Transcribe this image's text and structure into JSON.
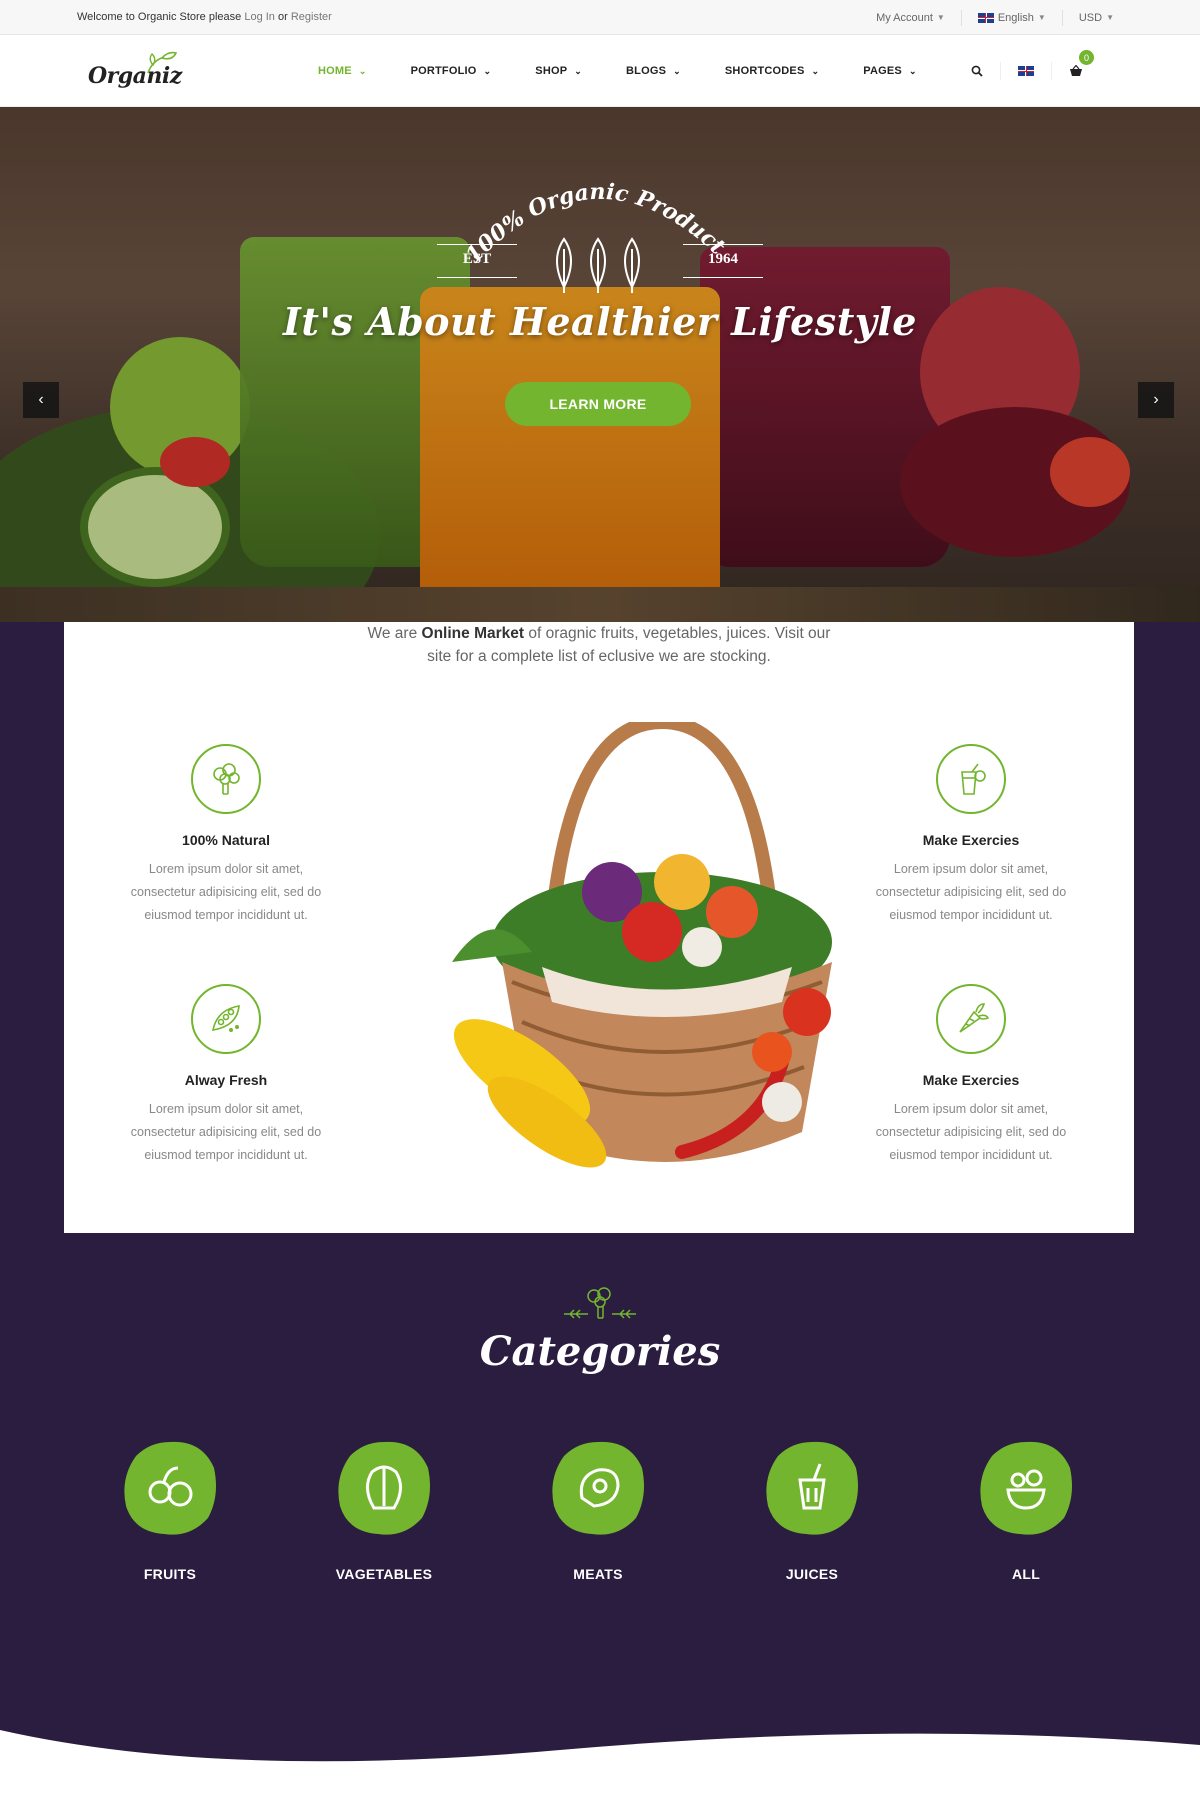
{
  "topbar": {
    "welcome_prefix": "Welcome to Organic Store please",
    "login": "Log In",
    "or": "or",
    "register": "Register",
    "account": "My Account",
    "language": "English",
    "currency": "USD"
  },
  "header": {
    "logo": "Organiz",
    "nav": [
      {
        "label": "HOME"
      },
      {
        "label": "PORTFOLIO"
      },
      {
        "label": "SHOP"
      },
      {
        "label": "BLOGS"
      },
      {
        "label": "SHORTCODES"
      },
      {
        "label": "PAGES"
      }
    ],
    "cart_count": "0"
  },
  "hero": {
    "tagline": "100% Organic Products",
    "est": "EST",
    "year": "1964",
    "title": "It's About Healthier Lifestyle",
    "button": "LEARN MORE"
  },
  "intro": {
    "prefix": "We are",
    "highlight": "Online Market",
    "line1_rest": "of oragnic fruits, vegetables, juices. Visit our",
    "line2": "site for a complete list of eclusive we are stocking."
  },
  "features": [
    {
      "title": "100% Natural",
      "icon": "broccoli-icon",
      "desc": "Lorem ipsum dolor sit amet, consectetur adipisicing elit, sed do eiusmod tempor incididunt ut."
    },
    {
      "title": "Alway Fresh",
      "icon": "peas-icon",
      "desc": "Lorem ipsum dolor sit amet, consectetur adipisicing elit, sed do eiusmod tempor incididunt ut."
    },
    {
      "title": "Make Exercies",
      "icon": "juice-icon",
      "desc": "Lorem ipsum dolor sit amet, consectetur adipisicing elit, sed do eiusmod tempor incididunt ut."
    },
    {
      "title": "Make Exercies",
      "icon": "carrot-icon",
      "desc": "Lorem ipsum dolor sit amet, consectetur adipisicing elit, sed do eiusmod tempor incididunt ut."
    }
  ],
  "categories": {
    "title": "Categories",
    "items": [
      {
        "label": "FRUITS",
        "icon": "fruit-icon"
      },
      {
        "label": "VAGETABLES",
        "icon": "lettuce-icon"
      },
      {
        "label": "MEATS",
        "icon": "meat-icon"
      },
      {
        "label": "JUICES",
        "icon": "drink-icon"
      },
      {
        "label": "ALL",
        "icon": "bowl-icon"
      }
    ]
  },
  "colors": {
    "accent": "#73b52e",
    "dark_section": "#2b1d3f",
    "topbar": "#f7f7f7"
  }
}
